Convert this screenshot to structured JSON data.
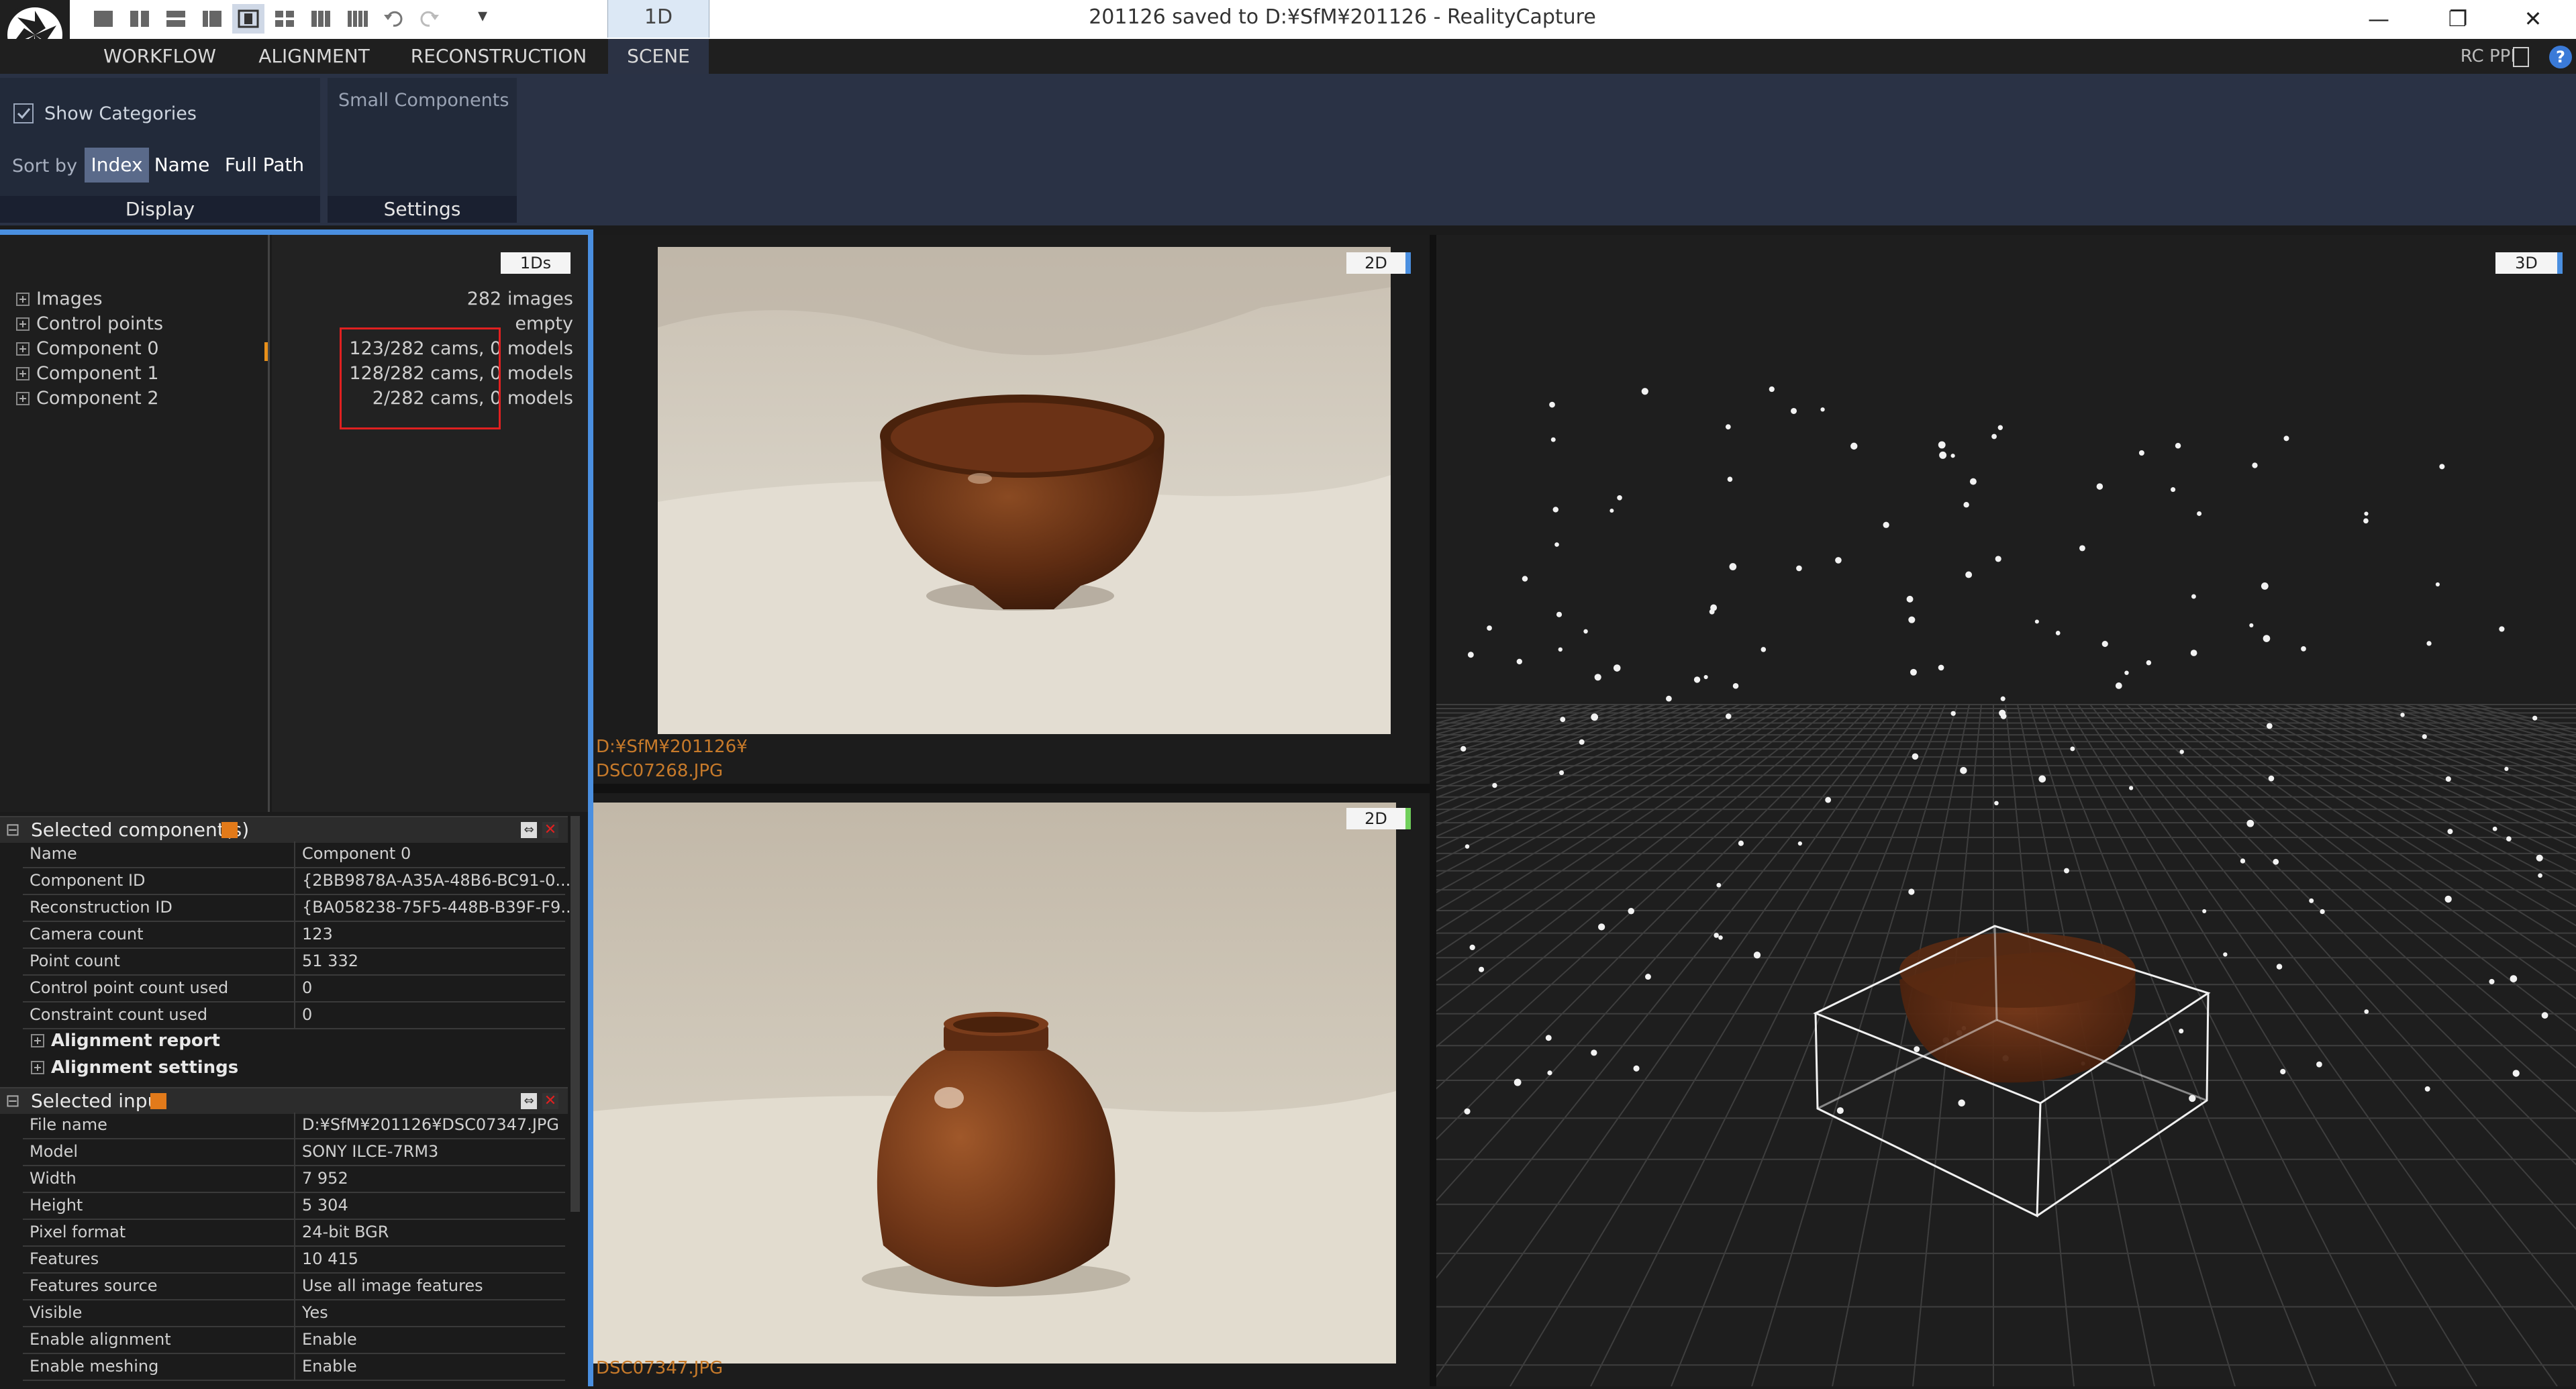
{
  "window": {
    "title": "201126 saved to D:¥SfM¥201126 - RealityCapture",
    "active_tab": "1D",
    "minimize": "—",
    "restore": "❐",
    "close": "✕",
    "dropdown": "▾"
  },
  "menu": {
    "items": [
      "WORKFLOW",
      "ALIGNMENT",
      "RECONSTRUCTION",
      "SCENE"
    ],
    "active": "SCENE",
    "right_label": "RC PPI",
    "help": "?"
  },
  "ribbon": {
    "show_categories": "Show Categories",
    "show_categories_checked": true,
    "sort_by": "Sort by",
    "sort_options": [
      "Index",
      "Name",
      "Full Path"
    ],
    "sort_selected": "Index",
    "small_components": "Small Components",
    "groups": [
      "Display",
      "Settings"
    ]
  },
  "tree": {
    "badge": "1Ds",
    "items": [
      {
        "label": "Images",
        "value": "282 images"
      },
      {
        "label": "Control points",
        "value": "empty"
      },
      {
        "label": "Component 0",
        "value": "123/282 cams, 0 models"
      },
      {
        "label": "Component 1",
        "value": "128/282 cams, 0 models"
      },
      {
        "label": "Component 2",
        "value": "2/282 cams, 0 models"
      }
    ]
  },
  "selected_component": {
    "title": "Selected component(s)",
    "rows": [
      {
        "key": "Name",
        "value": "Component 0"
      },
      {
        "key": "Component ID",
        "value": "{2BB9878A-A35A-48B6-BC91-0..."
      },
      {
        "key": "Reconstruction ID",
        "value": "{BA058238-75F5-448B-B39F-F9..."
      },
      {
        "key": "Camera count",
        "value": "123"
      },
      {
        "key": "Point count",
        "value": "51 332"
      },
      {
        "key": "Control point count used",
        "value": "0"
      },
      {
        "key": "Constraint count used",
        "value": "0"
      }
    ],
    "subsections": [
      "Alignment report",
      "Alignment settings"
    ]
  },
  "selected_input": {
    "title": "Selected input",
    "rows": [
      {
        "key": "File name",
        "value": "D:¥SfM¥201126¥DSC07347.JPG"
      },
      {
        "key": "Model",
        "value": "SONY ILCE-7RM3"
      },
      {
        "key": "Width",
        "value": "7 952"
      },
      {
        "key": "Height",
        "value": "5 304"
      },
      {
        "key": "Pixel format",
        "value": "24-bit BGR"
      },
      {
        "key": "Features",
        "value": "10 415"
      },
      {
        "key": "Features source",
        "value": "Use all image features"
      },
      {
        "key": "Visible",
        "value": "Yes"
      },
      {
        "key": "Enable alignment",
        "value": "Enable"
      },
      {
        "key": "Enable meshing",
        "value": "Enable"
      }
    ]
  },
  "views": {
    "top_image": {
      "badge": "2D",
      "path_line1": "D:¥SfM¥201126¥",
      "path_line2": "DSC07268.JPG"
    },
    "bottom_image": {
      "badge": "2D",
      "path_line1": "DSC07347.JPG"
    },
    "view3d": {
      "badge": "3D"
    }
  },
  "colors": {
    "accent": "#4a8fe0",
    "ribbon": "#2a3245",
    "highlight_box": "#e02020",
    "path_text": "#c77a2a",
    "wood": "#6b3216"
  }
}
